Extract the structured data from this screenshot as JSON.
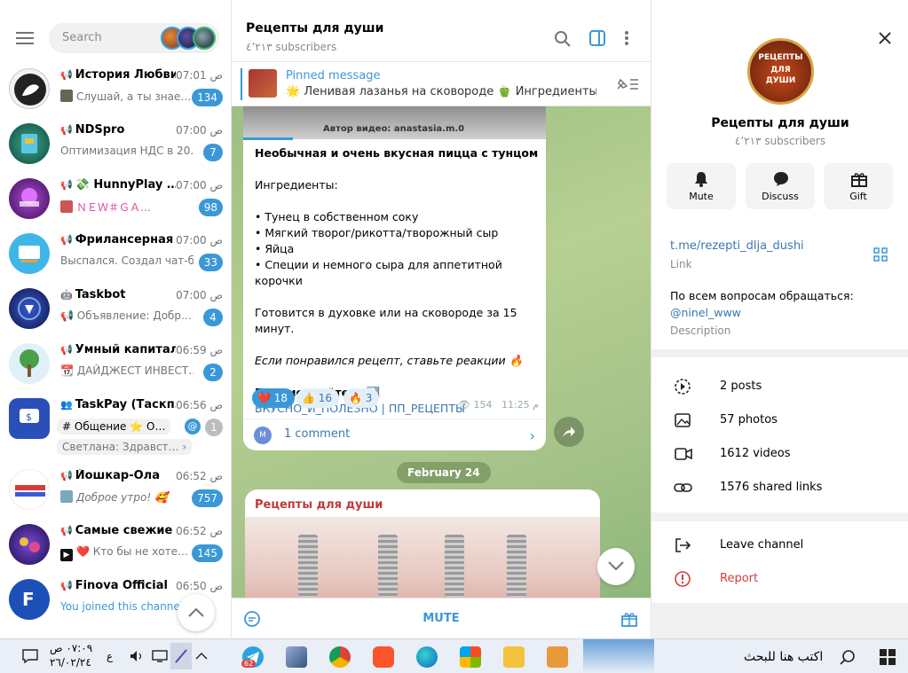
{
  "window": {
    "min_label": "—",
    "max_label": "❐",
    "close_label": "✕"
  },
  "search": {
    "placeholder": "Search"
  },
  "chats": [
    {
      "name": "История Любви",
      "time": "07:01 ص",
      "preview": "Слушай, а ты знае…",
      "badge": "134",
      "avatar_color": "#f2f2f2"
    },
    {
      "name": "NDSpro",
      "time": "07:00 ص",
      "preview": "Оптимизация НДС в 20…",
      "badge": "7",
      "avatar_color": "#1f6e5a"
    },
    {
      "name": "💸 HunnyPlay …",
      "time": "07:00 ص",
      "preview": "ＮＥＷ＃ＧＡ…",
      "badge": "98",
      "avatar_color": "#5a2a8a"
    },
    {
      "name": "Фрилансерная",
      "time": "07:00 ص",
      "preview": "Выспался. Создал чат-б…",
      "badge": "33",
      "avatar_color": "#3fb6e8"
    },
    {
      "name": "Taskbot",
      "time": "07:00 ص",
      "preview": "Объявление:  Добр…",
      "badge": "4",
      "avatar_color": "#1a2a6a"
    },
    {
      "name": "Умный капитал",
      "time": "06:59 ص",
      "preview": "ДАЙДЖЕСТ ИНВЕСТ…",
      "badge": "2",
      "avatar_color": "#7fbf6a"
    },
    {
      "name": "TaskPay (Таскп…",
      "time": "06:56 ص",
      "preview": "Светлана: Здравст…",
      "badge": "1",
      "avatar_color": "#1c3d8a",
      "topic": "# Общение",
      "badge_grey": true
    },
    {
      "name": "Йошкар-Ола",
      "time": "06:52 ص",
      "preview": "Доброе утро! 🥰",
      "badge": "757",
      "avatar_color": "#ffffff"
    },
    {
      "name": "Самые свежие …",
      "time": "06:52 ص",
      "preview": "Кто бы не хоте…",
      "badge": "145",
      "avatar_color": "#3a1f7a"
    },
    {
      "name": "Finova Official",
      "time": "06:50 ص",
      "preview": "You joined this channel",
      "badge": "",
      "avatar_color": "#1d4fb8"
    }
  ],
  "channel": {
    "title": "Рецепты для души",
    "subscribers": "٤٬٢١٣ subscribers",
    "pinned_label": "Pinned message",
    "pinned_text": "🌟 Ленивая лазанья на сковороде 🫑 Ингредиенты: …",
    "mute_label": "MUTE",
    "date_chip": "February 24"
  },
  "message1": {
    "image_caption": "Автор видео: anastasia.m.0",
    "lines": [
      "Необычная и очень вкусная пицца с тунцом",
      "",
      "Ингредиенты:",
      "",
      "• Тунец в собственном соку",
      "• Мягкий творог/рикотта/творожный сыр",
      "• Яйца",
      "• Специи и немного сыра для аппетитной корочки",
      "",
      "Готовится в духовке или на сковороде за 15 минут.",
      "",
      "Если понравился рецепт, ставьте реакции 🔥",
      "",
      "Подписывайтесь ⤵️",
      "ВКУСНО_И_ПОЛЕЗНО | ПП_РЕЦЕПТЫ"
    ],
    "reactions": [
      {
        "emoji": "❤️",
        "count": "18"
      },
      {
        "emoji": "👍",
        "count": "16"
      },
      {
        "emoji": "🔥",
        "count": "3"
      }
    ],
    "views": "154",
    "time": "11:25 م",
    "comment_avatar": "M",
    "comments": "1 comment"
  },
  "message2": {
    "author": "Рецепты для души"
  },
  "info": {
    "title": "Рецепты для души",
    "subscribers": "٤٬٢١٣ subscribers",
    "logo_line1": "РЕЦЕПТЫ",
    "logo_line2": "ДЛЯ",
    "logo_line3": "ДУШИ",
    "actions": [
      "Mute",
      "Discuss",
      "Gift"
    ],
    "link": "t.me/rezepti_dlja_dushi",
    "link_label": "Link",
    "description_text": "По всем вопросам обращаться:",
    "description_handle": "@ninel_www",
    "description_label": "Description",
    "stats": [
      "2 posts",
      "57 photos",
      "1612 videos",
      "1576 shared links"
    ],
    "leave": "Leave channel",
    "report": "Report"
  },
  "taskbar": {
    "search_text": "اكتب هنا للبحث",
    "clock_time": "٠٧:٠٩ ص",
    "clock_date": "٢٦/٠٢/٢٤",
    "lang": "ع",
    "telegram_badge": "62"
  }
}
